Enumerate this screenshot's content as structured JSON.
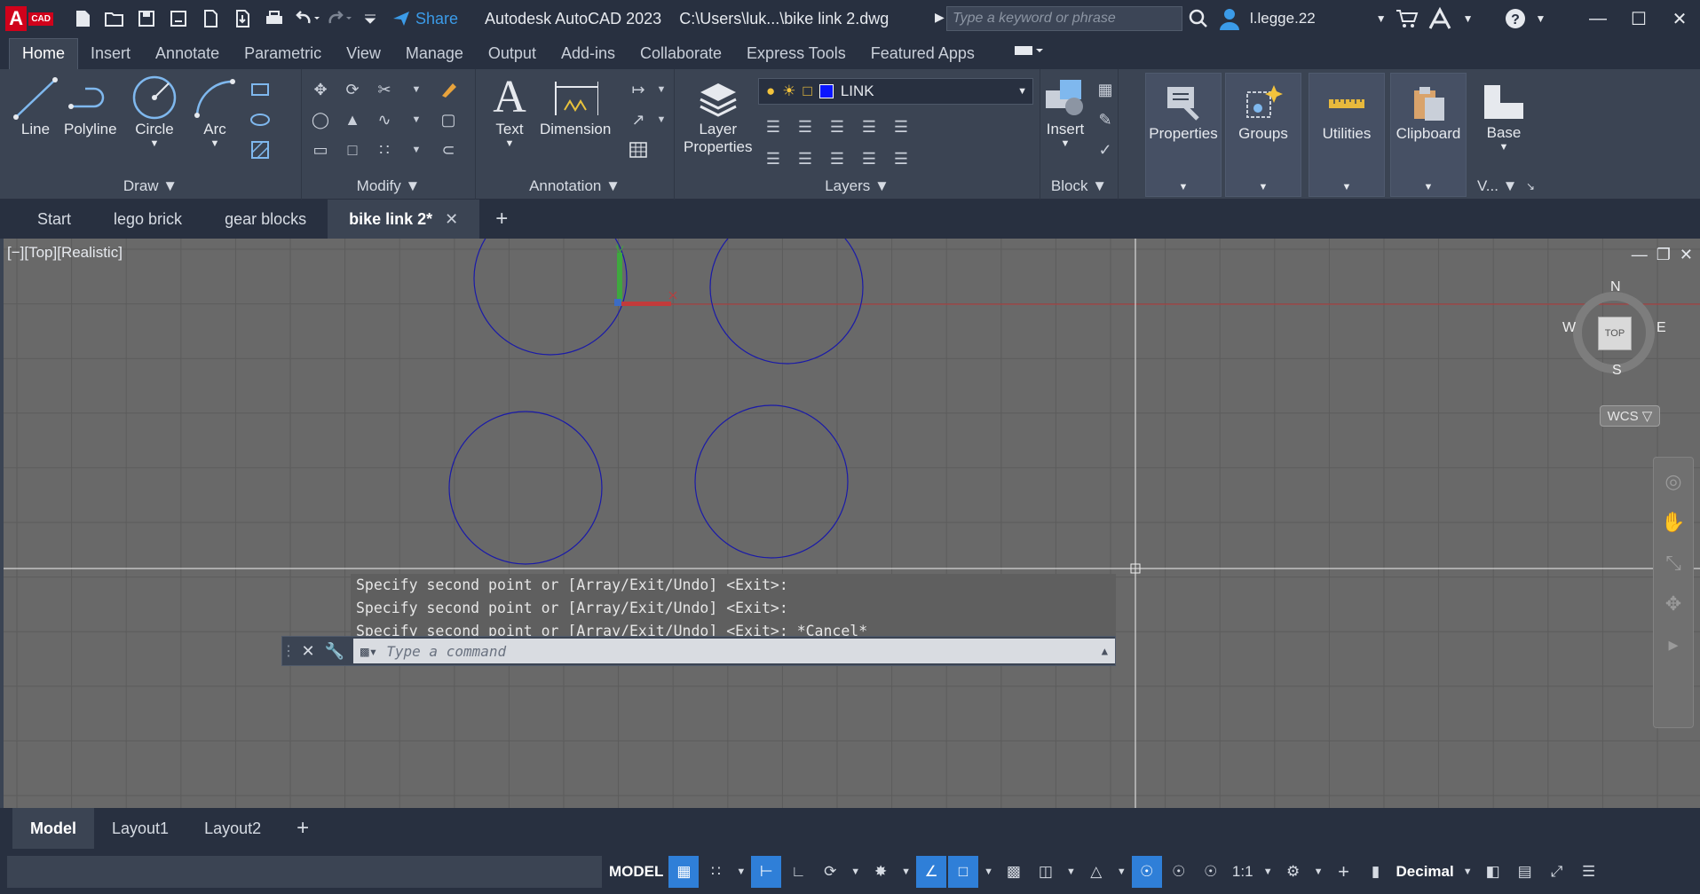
{
  "titlebar": {
    "logo_letter": "A",
    "logo_tag": "CAD",
    "share_label": "Share",
    "app_title": "Autodesk AutoCAD 2023",
    "file_path": "C:\\Users\\luk...\\bike link 2.dwg",
    "search_placeholder": "Type a keyword or phrase",
    "user_name": "l.legge.22"
  },
  "ribbon_tabs": [
    "Home",
    "Insert",
    "Annotate",
    "Parametric",
    "View",
    "Manage",
    "Output",
    "Add-ins",
    "Collaborate",
    "Express Tools",
    "Featured Apps"
  ],
  "ribbon": {
    "draw": {
      "title": "Draw",
      "line": "Line",
      "polyline": "Polyline",
      "circle": "Circle",
      "arc": "Arc"
    },
    "modify": {
      "title": "Modify"
    },
    "annotation": {
      "title": "Annotation",
      "text": "Text",
      "dimension": "Dimension"
    },
    "layers": {
      "title": "Layers",
      "layer_properties_1": "Layer",
      "layer_properties_2": "Properties",
      "current_layer": "LINK",
      "layer_color": "#0a16ff"
    },
    "block": {
      "title": "Block",
      "insert": "Insert"
    },
    "properties": "Properties",
    "groups": "Groups",
    "utilities": "Utilities",
    "clipboard": "Clipboard",
    "view": {
      "base": "Base",
      "title": "V..."
    }
  },
  "file_tabs": [
    {
      "label": "Start"
    },
    {
      "label": "lego brick"
    },
    {
      "label": "gear blocks"
    },
    {
      "label": "bike link 2*"
    }
  ],
  "viewport": {
    "label": "[−][Top][Realistic]",
    "viewcube": {
      "north": "N",
      "south": "S",
      "east": "E",
      "west": "W",
      "face": "TOP"
    },
    "wcs": "WCS ▽",
    "circle_color": "#1a1aa8"
  },
  "command": {
    "history": [
      "Specify second point or [Array/Exit/Undo] <Exit>:",
      "Specify second point or [Array/Exit/Undo] <Exit>:",
      "Specify second point or [Array/Exit/Undo] <Exit>: *Cancel*"
    ],
    "placeholder": "Type a command"
  },
  "layout_tabs": [
    "Model",
    "Layout1",
    "Layout2"
  ],
  "statusbar": {
    "model": "MODEL",
    "scale": "1:1",
    "units": "Decimal"
  }
}
